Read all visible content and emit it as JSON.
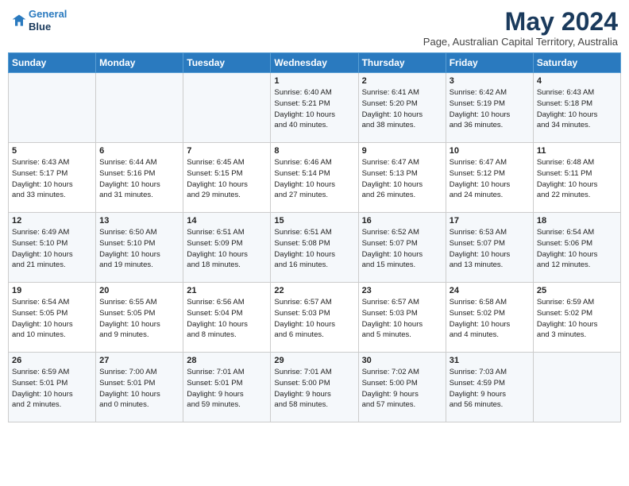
{
  "header": {
    "logo_line1": "General",
    "logo_line2": "Blue",
    "month": "May 2024",
    "location": "Page, Australian Capital Territory, Australia"
  },
  "days_of_week": [
    "Sunday",
    "Monday",
    "Tuesday",
    "Wednesday",
    "Thursday",
    "Friday",
    "Saturday"
  ],
  "weeks": [
    [
      {
        "day": "",
        "info": ""
      },
      {
        "day": "",
        "info": ""
      },
      {
        "day": "",
        "info": ""
      },
      {
        "day": "1",
        "info": "Sunrise: 6:40 AM\nSunset: 5:21 PM\nDaylight: 10 hours\nand 40 minutes."
      },
      {
        "day": "2",
        "info": "Sunrise: 6:41 AM\nSunset: 5:20 PM\nDaylight: 10 hours\nand 38 minutes."
      },
      {
        "day": "3",
        "info": "Sunrise: 6:42 AM\nSunset: 5:19 PM\nDaylight: 10 hours\nand 36 minutes."
      },
      {
        "day": "4",
        "info": "Sunrise: 6:43 AM\nSunset: 5:18 PM\nDaylight: 10 hours\nand 34 minutes."
      }
    ],
    [
      {
        "day": "5",
        "info": "Sunrise: 6:43 AM\nSunset: 5:17 PM\nDaylight: 10 hours\nand 33 minutes."
      },
      {
        "day": "6",
        "info": "Sunrise: 6:44 AM\nSunset: 5:16 PM\nDaylight: 10 hours\nand 31 minutes."
      },
      {
        "day": "7",
        "info": "Sunrise: 6:45 AM\nSunset: 5:15 PM\nDaylight: 10 hours\nand 29 minutes."
      },
      {
        "day": "8",
        "info": "Sunrise: 6:46 AM\nSunset: 5:14 PM\nDaylight: 10 hours\nand 27 minutes."
      },
      {
        "day": "9",
        "info": "Sunrise: 6:47 AM\nSunset: 5:13 PM\nDaylight: 10 hours\nand 26 minutes."
      },
      {
        "day": "10",
        "info": "Sunrise: 6:47 AM\nSunset: 5:12 PM\nDaylight: 10 hours\nand 24 minutes."
      },
      {
        "day": "11",
        "info": "Sunrise: 6:48 AM\nSunset: 5:11 PM\nDaylight: 10 hours\nand 22 minutes."
      }
    ],
    [
      {
        "day": "12",
        "info": "Sunrise: 6:49 AM\nSunset: 5:10 PM\nDaylight: 10 hours\nand 21 minutes."
      },
      {
        "day": "13",
        "info": "Sunrise: 6:50 AM\nSunset: 5:10 PM\nDaylight: 10 hours\nand 19 minutes."
      },
      {
        "day": "14",
        "info": "Sunrise: 6:51 AM\nSunset: 5:09 PM\nDaylight: 10 hours\nand 18 minutes."
      },
      {
        "day": "15",
        "info": "Sunrise: 6:51 AM\nSunset: 5:08 PM\nDaylight: 10 hours\nand 16 minutes."
      },
      {
        "day": "16",
        "info": "Sunrise: 6:52 AM\nSunset: 5:07 PM\nDaylight: 10 hours\nand 15 minutes."
      },
      {
        "day": "17",
        "info": "Sunrise: 6:53 AM\nSunset: 5:07 PM\nDaylight: 10 hours\nand 13 minutes."
      },
      {
        "day": "18",
        "info": "Sunrise: 6:54 AM\nSunset: 5:06 PM\nDaylight: 10 hours\nand 12 minutes."
      }
    ],
    [
      {
        "day": "19",
        "info": "Sunrise: 6:54 AM\nSunset: 5:05 PM\nDaylight: 10 hours\nand 10 minutes."
      },
      {
        "day": "20",
        "info": "Sunrise: 6:55 AM\nSunset: 5:05 PM\nDaylight: 10 hours\nand 9 minutes."
      },
      {
        "day": "21",
        "info": "Sunrise: 6:56 AM\nSunset: 5:04 PM\nDaylight: 10 hours\nand 8 minutes."
      },
      {
        "day": "22",
        "info": "Sunrise: 6:57 AM\nSunset: 5:03 PM\nDaylight: 10 hours\nand 6 minutes."
      },
      {
        "day": "23",
        "info": "Sunrise: 6:57 AM\nSunset: 5:03 PM\nDaylight: 10 hours\nand 5 minutes."
      },
      {
        "day": "24",
        "info": "Sunrise: 6:58 AM\nSunset: 5:02 PM\nDaylight: 10 hours\nand 4 minutes."
      },
      {
        "day": "25",
        "info": "Sunrise: 6:59 AM\nSunset: 5:02 PM\nDaylight: 10 hours\nand 3 minutes."
      }
    ],
    [
      {
        "day": "26",
        "info": "Sunrise: 6:59 AM\nSunset: 5:01 PM\nDaylight: 10 hours\nand 2 minutes."
      },
      {
        "day": "27",
        "info": "Sunrise: 7:00 AM\nSunset: 5:01 PM\nDaylight: 10 hours\nand 0 minutes."
      },
      {
        "day": "28",
        "info": "Sunrise: 7:01 AM\nSunset: 5:01 PM\nDaylight: 9 hours\nand 59 minutes."
      },
      {
        "day": "29",
        "info": "Sunrise: 7:01 AM\nSunset: 5:00 PM\nDaylight: 9 hours\nand 58 minutes."
      },
      {
        "day": "30",
        "info": "Sunrise: 7:02 AM\nSunset: 5:00 PM\nDaylight: 9 hours\nand 57 minutes."
      },
      {
        "day": "31",
        "info": "Sunrise: 7:03 AM\nSunset: 4:59 PM\nDaylight: 9 hours\nand 56 minutes."
      },
      {
        "day": "",
        "info": ""
      }
    ]
  ]
}
